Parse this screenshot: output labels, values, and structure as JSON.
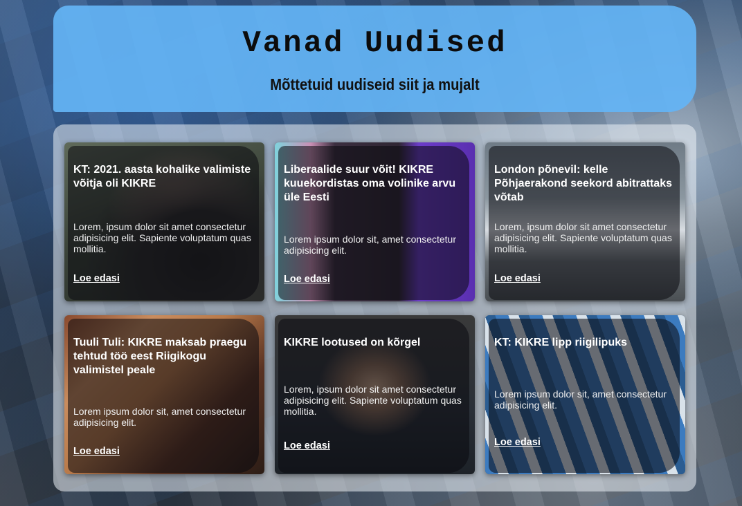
{
  "header": {
    "title": "Vanad Uudised",
    "subtitle": "Mõttetuid uudiseid siit ja mujalt"
  },
  "articles": [
    {
      "title": "KT: 2021. aasta kohalike valimiste võitja oli KIKRE",
      "text": "Lorem, ipsum dolor sit amet consectetur adipisicing elit. Sapiente voluptatum quas mollitia.",
      "link": "Loe edasi"
    },
    {
      "title": "Liberaalide suur võit! KIKRE kuuekordistas oma volinike arvu üle Eesti",
      "text": "Lorem ipsum dolor sit, amet consectetur adipisicing elit.",
      "link": "Loe edasi"
    },
    {
      "title": "London põnevil: kelle Põhjaerakond seekord abitrattaks võtab",
      "text": "Lorem, ipsum dolor sit amet consectetur adipisicing elit. Sapiente voluptatum quas mollitia.",
      "link": "Loe edasi"
    },
    {
      "title": "Tuuli Tuli: KIKRE maksab praegu tehtud töö eest Riigikogu valimistel peale",
      "text": "Lorem ipsum dolor sit, amet consectetur adipisicing elit.",
      "link": "Loe edasi"
    },
    {
      "title": "KIKRE lootused on kõrgel",
      "text": "Lorem, ipsum dolor sit amet consectetur adipisicing elit. Sapiente voluptatum quas mollitia.",
      "link": "Loe edasi"
    },
    {
      "title": "KT: KIKRE lipp riigilipuks",
      "text": "Lorem ipsum dolor sit, amet consectetur adipisicing elit.",
      "link": "Loe edasi"
    }
  ]
}
